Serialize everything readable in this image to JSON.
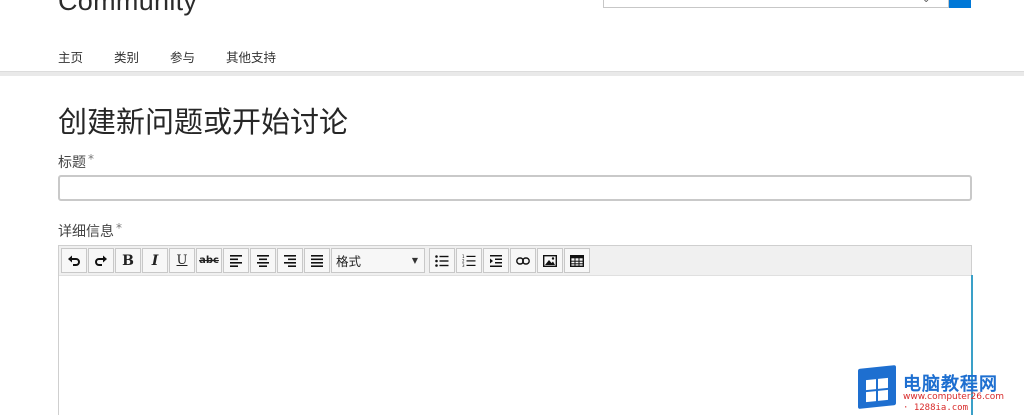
{
  "header": {
    "brand": "Community",
    "search": {
      "placeholder": ""
    }
  },
  "nav": {
    "items": [
      {
        "label": "主页"
      },
      {
        "label": "类别"
      },
      {
        "label": "参与"
      },
      {
        "label": "其他支持"
      }
    ]
  },
  "form": {
    "title": "创建新问题或开始讨论",
    "subject_label": "标题",
    "subject_required": "*",
    "subject_value": "",
    "details_label": "详细信息",
    "details_required": "*",
    "toolbar": {
      "undo_icon": "undo-icon",
      "redo_icon": "redo-icon",
      "bold": "B",
      "italic": "I",
      "underline": "U",
      "strike": "abc",
      "format_select": "格式",
      "format_arrow": "▼"
    }
  },
  "watermark": {
    "name": "电脑教程网",
    "url": "www.computer26.com",
    "url2": "· 1288ia.com"
  },
  "colors": {
    "accent": "#0078d7",
    "divider": "#e9e9e9",
    "watermark_blue": "#1e6fd0",
    "watermark_red": "#d82a2a"
  }
}
